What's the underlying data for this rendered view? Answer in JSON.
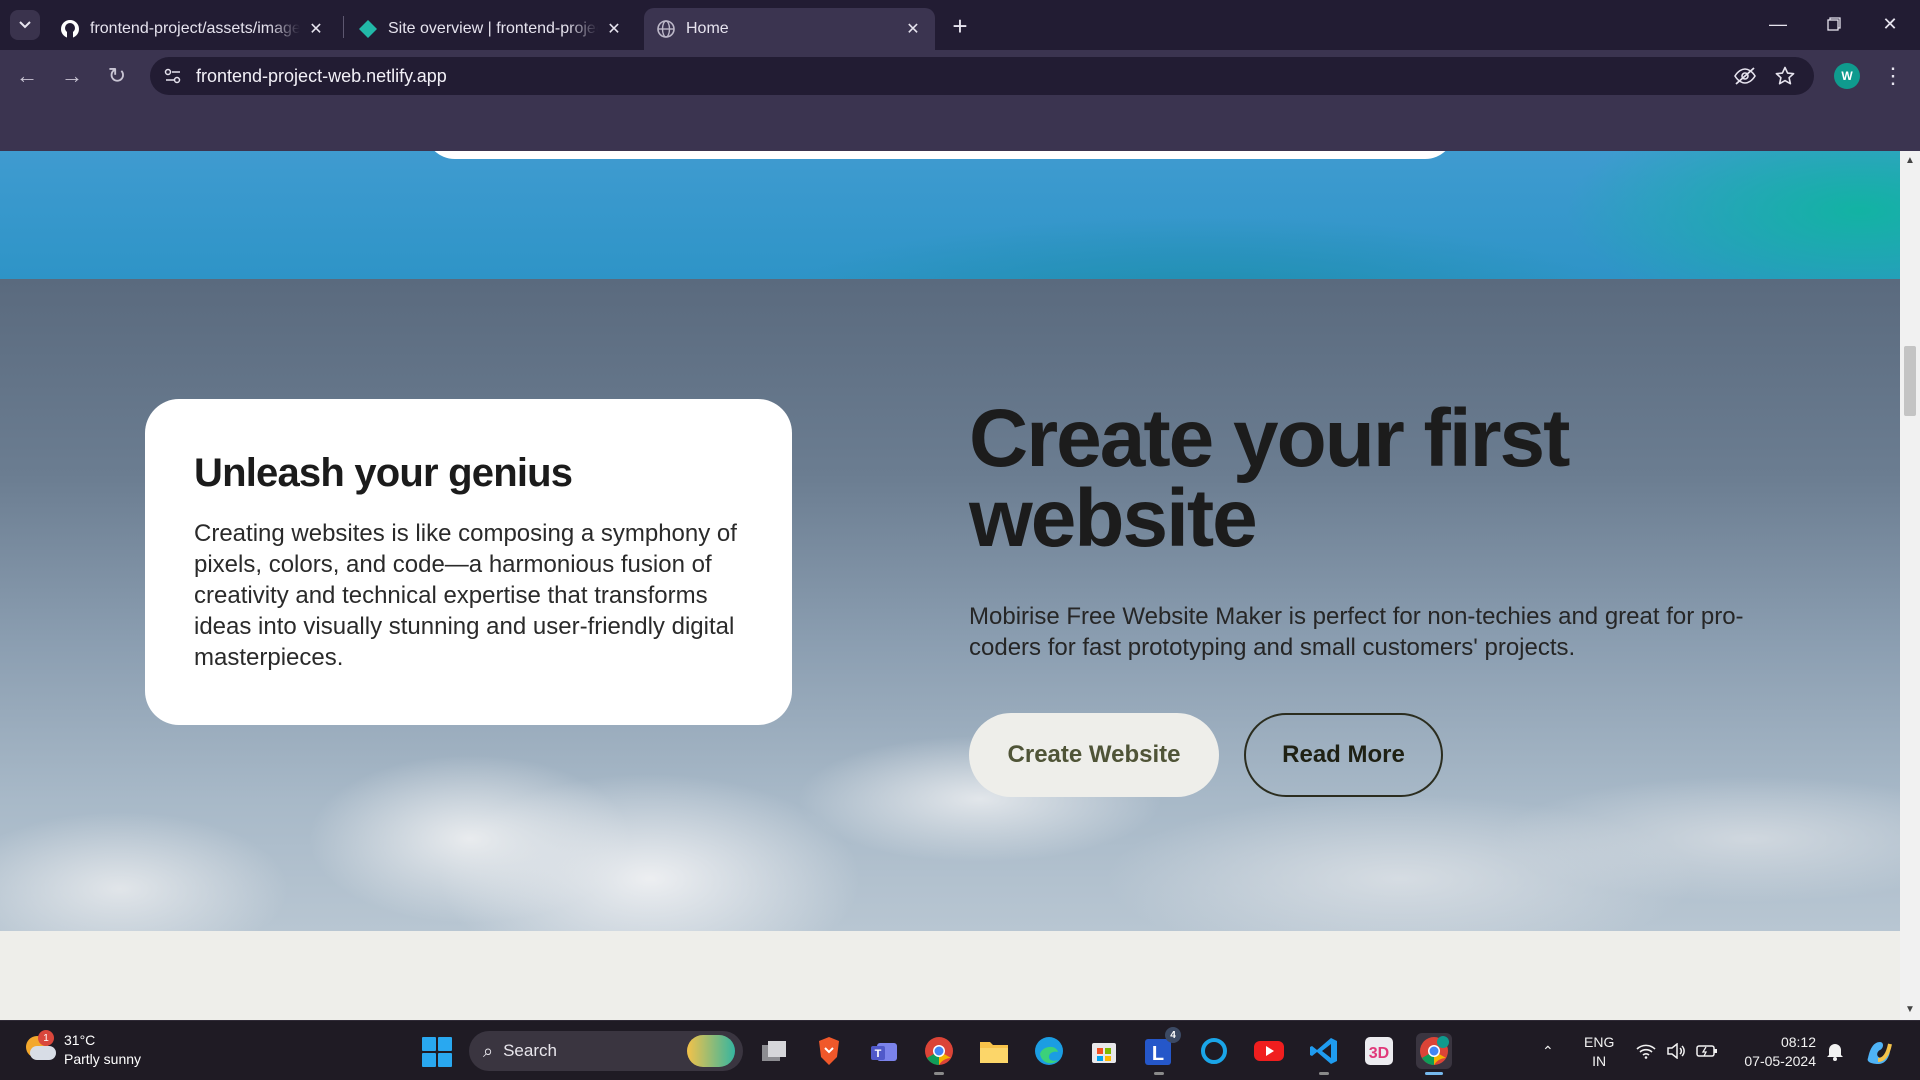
{
  "browser": {
    "tabs": [
      {
        "title": "frontend-project/assets/images",
        "favicon": "github-icon"
      },
      {
        "title": "Site overview | frontend-project",
        "favicon": "netlify-icon"
      },
      {
        "title": "Home",
        "favicon": "globe-icon",
        "active": true
      }
    ],
    "url": "frontend-project-web.netlify.app",
    "profile_initial": "W"
  },
  "page": {
    "genius_card": {
      "title": "Unleash your genius",
      "body": "Creating websites is like composing a symphony of pixels, colors, and code—a harmonious fusion of creativity and technical expertise that transforms ideas into visually stunning and user-friendly digital masterpieces."
    },
    "hero": {
      "title": "Create your first website",
      "subtitle": "Mobirise Free Website Maker is perfect for non-techies and great for pro-coders for fast prototyping and small customers' projects.",
      "primary_button": "Create Website",
      "secondary_button": "Read More"
    }
  },
  "taskbar": {
    "weather": {
      "temp": "31°C",
      "condition": "Partly sunny",
      "badge": "1"
    },
    "search_placeholder": "Search",
    "apps": [
      {
        "name": "task-view",
        "label": ""
      },
      {
        "name": "brave-browser",
        "label": ""
      },
      {
        "name": "teams",
        "label": "T"
      },
      {
        "name": "chrome",
        "label": ""
      },
      {
        "name": "file-explorer",
        "label": ""
      },
      {
        "name": "edge",
        "label": ""
      },
      {
        "name": "microsoft-store",
        "label": ""
      },
      {
        "name": "l-app",
        "label": "L",
        "badge": "4"
      },
      {
        "name": "cortana",
        "label": ""
      },
      {
        "name": "youtube",
        "label": ""
      },
      {
        "name": "vscode",
        "label": ""
      },
      {
        "name": "3d-app",
        "label": "3D"
      },
      {
        "name": "chrome-profile",
        "label": ""
      }
    ],
    "language": {
      "line1": "ENG",
      "line2": "IN"
    },
    "time": "08:12",
    "date": "07-05-2024"
  }
}
